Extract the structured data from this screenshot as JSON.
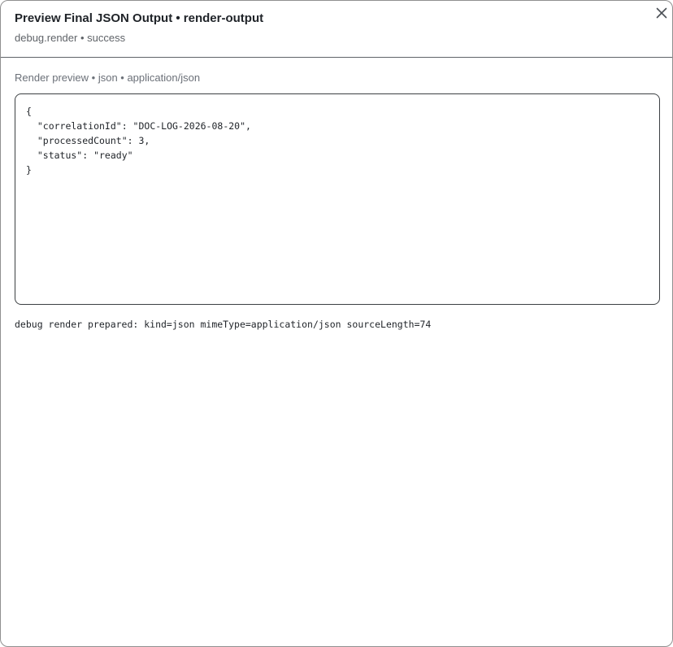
{
  "dialog": {
    "title": "Preview Final JSON Output • render-output",
    "subtitle": "debug.render • success",
    "close_icon": "close-icon"
  },
  "preview": {
    "label": "Render preview • json • application/json",
    "code": "{\n  \"correlationId\": \"DOC-LOG-2026-08-20\",\n  \"processedCount\": 3,\n  \"status\": \"ready\"\n}"
  },
  "status_message": "debug render prepared: kind=json mimeType=application/json sourceLength=74"
}
